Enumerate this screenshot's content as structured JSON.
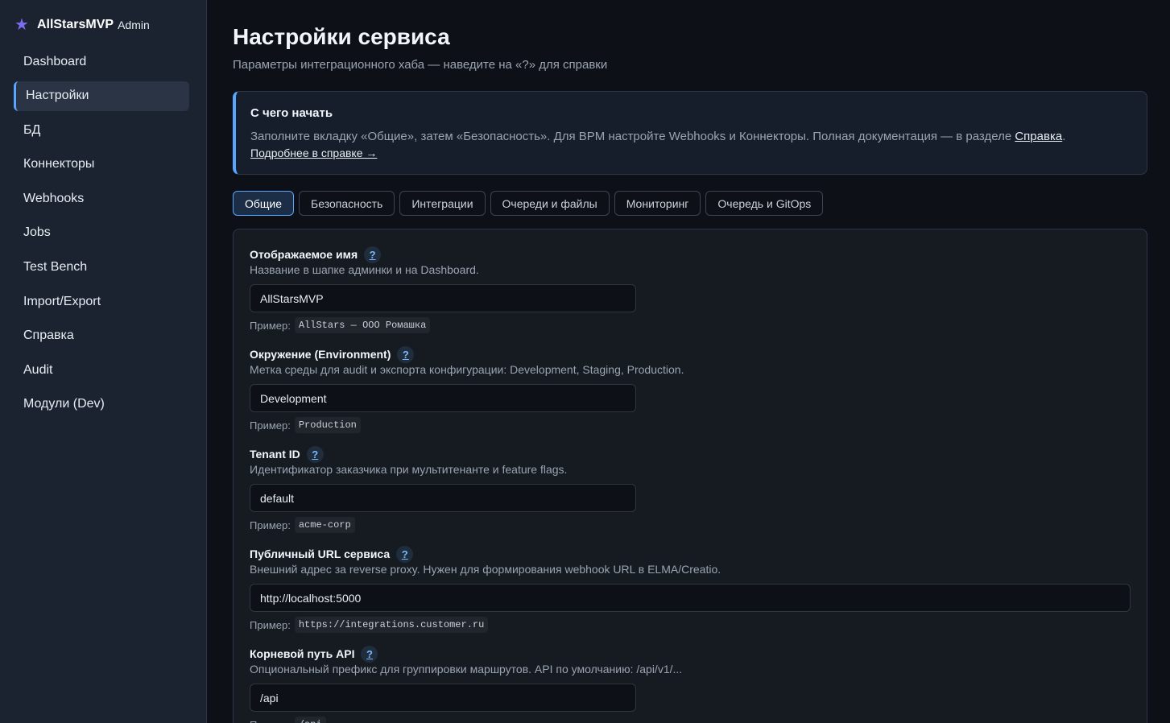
{
  "brand": {
    "name": "AllStarsMVP",
    "sub": "Admin"
  },
  "sidebar": {
    "items": [
      {
        "label": "Dashboard"
      },
      {
        "label": "Настройки"
      },
      {
        "label": "БД"
      },
      {
        "label": "Коннекторы"
      },
      {
        "label": "Webhooks"
      },
      {
        "label": "Jobs"
      },
      {
        "label": "Test Bench"
      },
      {
        "label": "Import/Export"
      },
      {
        "label": "Справка"
      },
      {
        "label": "Audit"
      },
      {
        "label": "Модули (Dev)"
      }
    ],
    "active_index": 1
  },
  "header": {
    "title": "Настройки сервиса",
    "subtitle": "Параметры интеграционного хаба — наведите на «?» для справки"
  },
  "callout": {
    "title": "С чего начать",
    "text": "Заполните вкладку «Общие», затем «Безопасность». Для BPM настройте Webhooks и Коннекторы. Полная документация — в разделе ",
    "link": "Справка",
    "text_end": ".",
    "more_link": "Подробнее в справке →"
  },
  "tabs": [
    {
      "label": "Общие"
    },
    {
      "label": "Безопасность"
    },
    {
      "label": "Интеграции"
    },
    {
      "label": "Очереди и файлы"
    },
    {
      "label": "Мониторинг"
    },
    {
      "label": "Очередь и GitOps"
    }
  ],
  "help_glyph": "?",
  "example_prefix": "Пример:",
  "fields": [
    {
      "label": "Отображаемое имя",
      "desc": "Название в шапке админки и на Dashboard.",
      "value": "AllStarsMVP",
      "example": "AllStars — ООО Ромашка"
    },
    {
      "label": "Окружение (Environment)",
      "desc": "Метка среды для audit и экспорта конфигурации: Development, Staging, Production.",
      "value": "Development",
      "example": "Production"
    },
    {
      "label": "Tenant ID",
      "desc": "Идентификатор заказчика при мультитенанте и feature flags.",
      "value": "default",
      "example": "acme-corp"
    },
    {
      "label": "Публичный URL сервиса",
      "desc": "Внешний адрес за reverse proxy. Нужен для формирования webhook URL в ELMA/Creatio.",
      "value": "http://localhost:5000",
      "example": "https://integrations.customer.ru"
    },
    {
      "label": "Корневой путь API",
      "desc": "Опциональный префикс для группировки маршрутов. API по умолчанию: /api/v1/...",
      "value": "/api",
      "example": "/api"
    }
  ],
  "colors": {
    "accent": "#58a6ff",
    "brand_star": "#7c6cf0",
    "background": "#0d1117",
    "sidebar": "#1b2330"
  }
}
